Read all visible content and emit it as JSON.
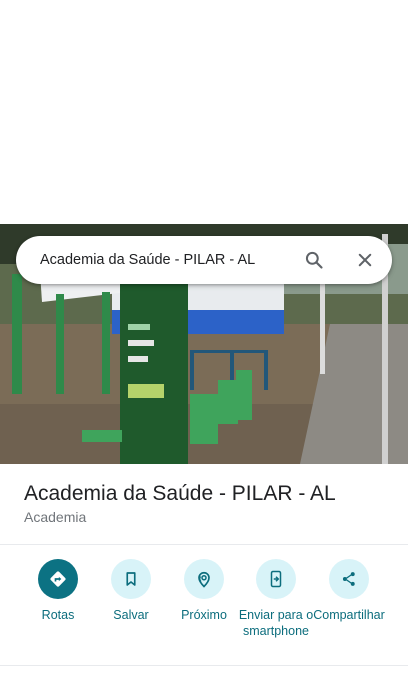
{
  "search": {
    "query": "Academia da Saúde - PILAR - AL",
    "search_icon": "search-icon",
    "close_icon": "close-icon"
  },
  "photo": {
    "kind": "street-view",
    "sign_text": "Saúde"
  },
  "place": {
    "name": "Academia da Saúde - PILAR - AL",
    "category": "Academia"
  },
  "actions": [
    {
      "label": "Rotas",
      "icon": "directions-icon",
      "primary": true
    },
    {
      "label": "Salvar",
      "icon": "bookmark-icon",
      "primary": false
    },
    {
      "label": "Próximo",
      "icon": "nearby-icon",
      "primary": false
    },
    {
      "label": "Enviar para o smartphone",
      "icon": "send-to-phone-icon",
      "primary": false
    },
    {
      "label": "Compartilhar",
      "icon": "share-icon",
      "primary": false
    }
  ],
  "colors": {
    "accent": "#0c7283",
    "action_bg": "#d8f3f8",
    "action_text": "#0c6d7d"
  }
}
